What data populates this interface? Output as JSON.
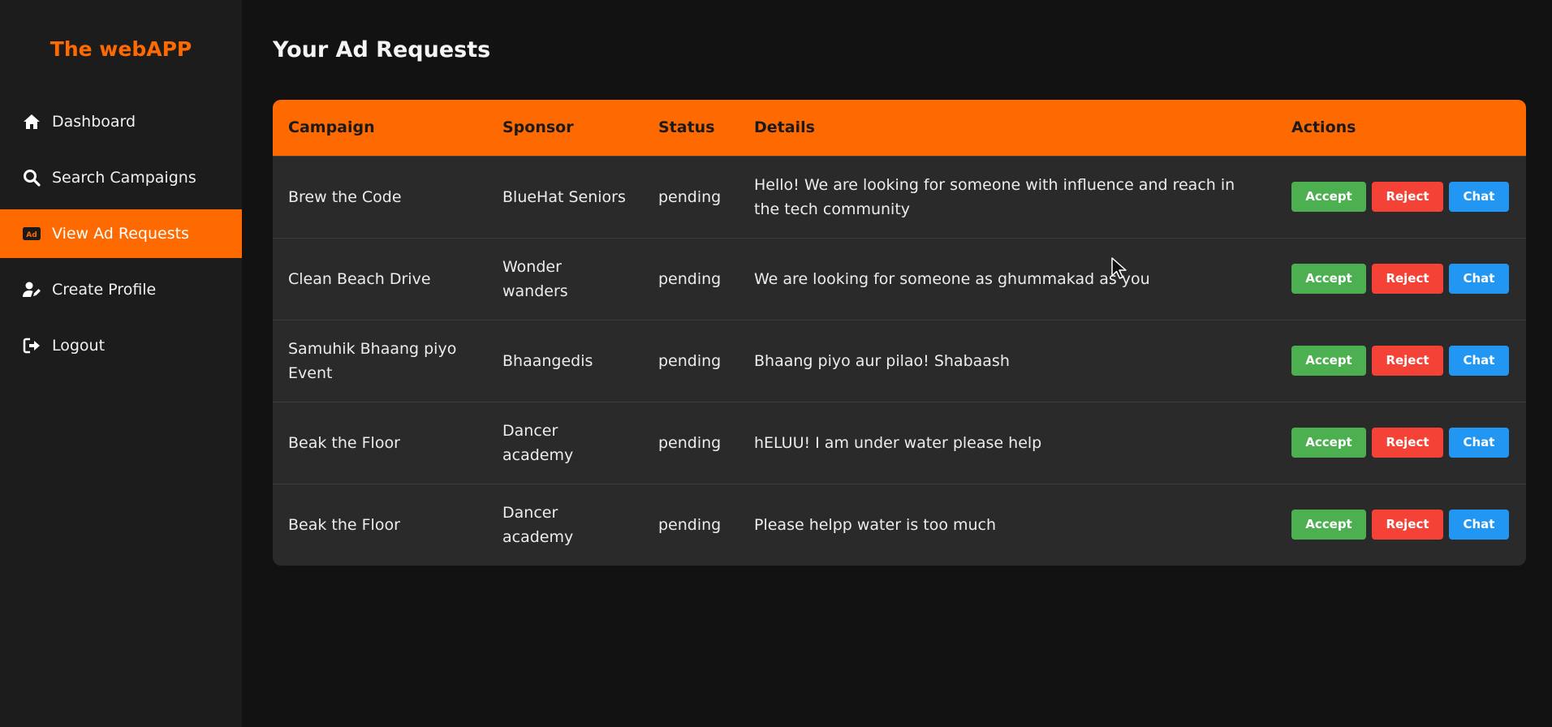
{
  "app": {
    "brand": "The webAPP"
  },
  "sidebar": {
    "items": [
      {
        "label": "Dashboard",
        "icon": "home-icon",
        "active": false
      },
      {
        "label": "Search Campaigns",
        "icon": "search-icon",
        "active": false
      },
      {
        "label": "View Ad Requests",
        "icon": "ad-icon",
        "active": true
      },
      {
        "label": "Create Profile",
        "icon": "user-edit-icon",
        "active": false
      },
      {
        "label": "Logout",
        "icon": "logout-icon",
        "active": false
      }
    ]
  },
  "main": {
    "title": "Your Ad Requests",
    "table": {
      "headers": [
        "Campaign",
        "Sponsor",
        "Status",
        "Details",
        "Actions"
      ],
      "rows": [
        {
          "campaign": "Brew the Code",
          "sponsor": "BlueHat Seniors",
          "status": "pending",
          "details": "Hello! We are looking for someone with influence and reach in the tech community"
        },
        {
          "campaign": "Clean Beach Drive",
          "sponsor": "Wonder wanders",
          "status": "pending",
          "details": "We are looking for someone as ghummakad as you"
        },
        {
          "campaign": "Samuhik Bhaang piyo Event",
          "sponsor": "Bhaangedis",
          "status": "pending",
          "details": "Bhaang piyo aur pilao! Shabaash"
        },
        {
          "campaign": "Beak the Floor",
          "sponsor": "Dancer academy",
          "status": "pending",
          "details": "hELUU! I am under water please help"
        },
        {
          "campaign": "Beak the Floor",
          "sponsor": "Dancer academy",
          "status": "pending",
          "details": "Please helpp water is too much"
        }
      ],
      "actions": {
        "accept": "Accept",
        "reject": "Reject",
        "chat": "Chat"
      }
    }
  },
  "colors": {
    "accent": "#ff6a00",
    "accept": "#4caf50",
    "reject": "#f44336",
    "chat": "#2196f3"
  }
}
